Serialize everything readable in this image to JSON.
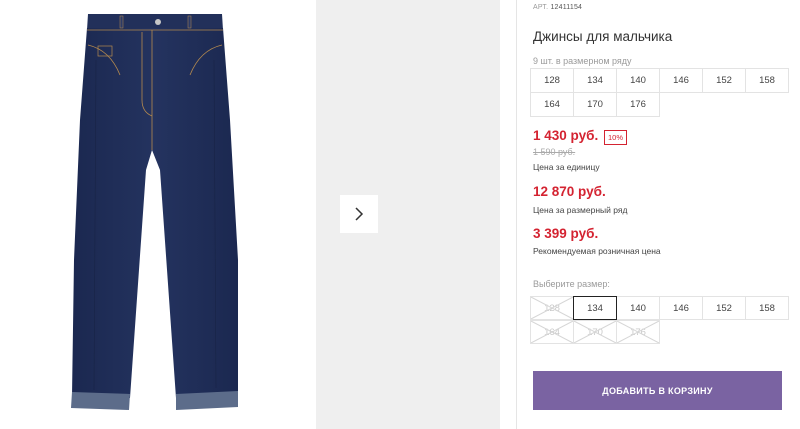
{
  "product": {
    "sku_prefix": "АРТ.",
    "sku": "12411154",
    "title": "Джинсы для мальчика",
    "series_label": "9 шт. в размерном ряду",
    "series_sizes": [
      "128",
      "134",
      "140",
      "146",
      "152",
      "158",
      "164",
      "170",
      "176"
    ]
  },
  "pricing": {
    "unit_price": "1 430 руб.",
    "discount_badge": "10%",
    "old_price": "1 590 руб.",
    "unit_caption": "Цена за единицу",
    "series_price": "12 870 руб.",
    "series_caption": "Цена за размерный ряд",
    "retail_price": "3 399 руб.",
    "retail_caption": "Рекомендуемая розничная цена"
  },
  "size_picker": {
    "label": "Выберите размер:",
    "options": [
      {
        "label": "128",
        "state": "disabled"
      },
      {
        "label": "134",
        "state": "selected"
      },
      {
        "label": "140",
        "state": "available"
      },
      {
        "label": "146",
        "state": "available"
      },
      {
        "label": "152",
        "state": "available"
      },
      {
        "label": "158",
        "state": "available"
      },
      {
        "label": "164",
        "state": "disabled"
      },
      {
        "label": "170",
        "state": "disabled"
      },
      {
        "label": "176",
        "state": "disabled"
      }
    ]
  },
  "actions": {
    "add_to_cart": "ДОБАВИТЬ В КОРЗИНУ"
  },
  "gallery": {
    "next_icon": "chevron-right-icon"
  },
  "colors": {
    "accent": "#7a63a2",
    "price": "#d42331",
    "denim": "#1f2d55"
  }
}
